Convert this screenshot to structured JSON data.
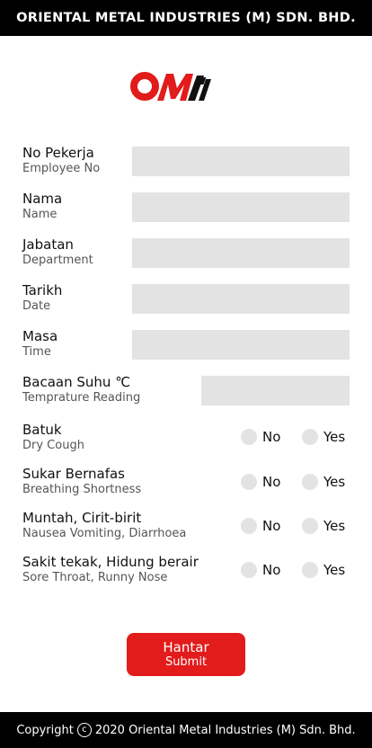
{
  "header": {
    "title": "ORIENTAL METAL INDUSTRIES (M) SDN. BHD."
  },
  "logo": {
    "text": "OMI",
    "icon": "omi-logo"
  },
  "fields": [
    {
      "label": "No Pekerja",
      "sublabel": "Employee No",
      "value": ""
    },
    {
      "label": "Nama",
      "sublabel": "Name",
      "value": ""
    },
    {
      "label": "Jabatan",
      "sublabel": "Department",
      "value": ""
    },
    {
      "label": "Tarikh",
      "sublabel": "Date",
      "value": ""
    },
    {
      "label": "Masa",
      "sublabel": "Time",
      "value": ""
    },
    {
      "label": "Bacaan Suhu ℃",
      "sublabel": "Temprature Reading",
      "value": ""
    }
  ],
  "questions": [
    {
      "label": "Batuk",
      "sublabel": "Dry Cough"
    },
    {
      "label": "Sukar Bernafas",
      "sublabel": "Breathing Shortness"
    },
    {
      "label": "Muntah, Cirit-birit",
      "sublabel": "Nausea Vomiting, Diarrhoea"
    },
    {
      "label": "Sakit tekak, Hidung berair",
      "sublabel": "Sore Throat, Runny Nose"
    }
  ],
  "options": {
    "no": "No",
    "yes": "Yes"
  },
  "submit": {
    "label": "Hantar",
    "sublabel": "Submit"
  },
  "footer": {
    "prefix": "Copyright",
    "symbol": "c",
    "text": "2020 Oriental Metal Industries (M) Sdn. Bhd."
  },
  "colors": {
    "accent": "#e21b1b",
    "bar": "#000000",
    "field": "#e3e3e3"
  }
}
